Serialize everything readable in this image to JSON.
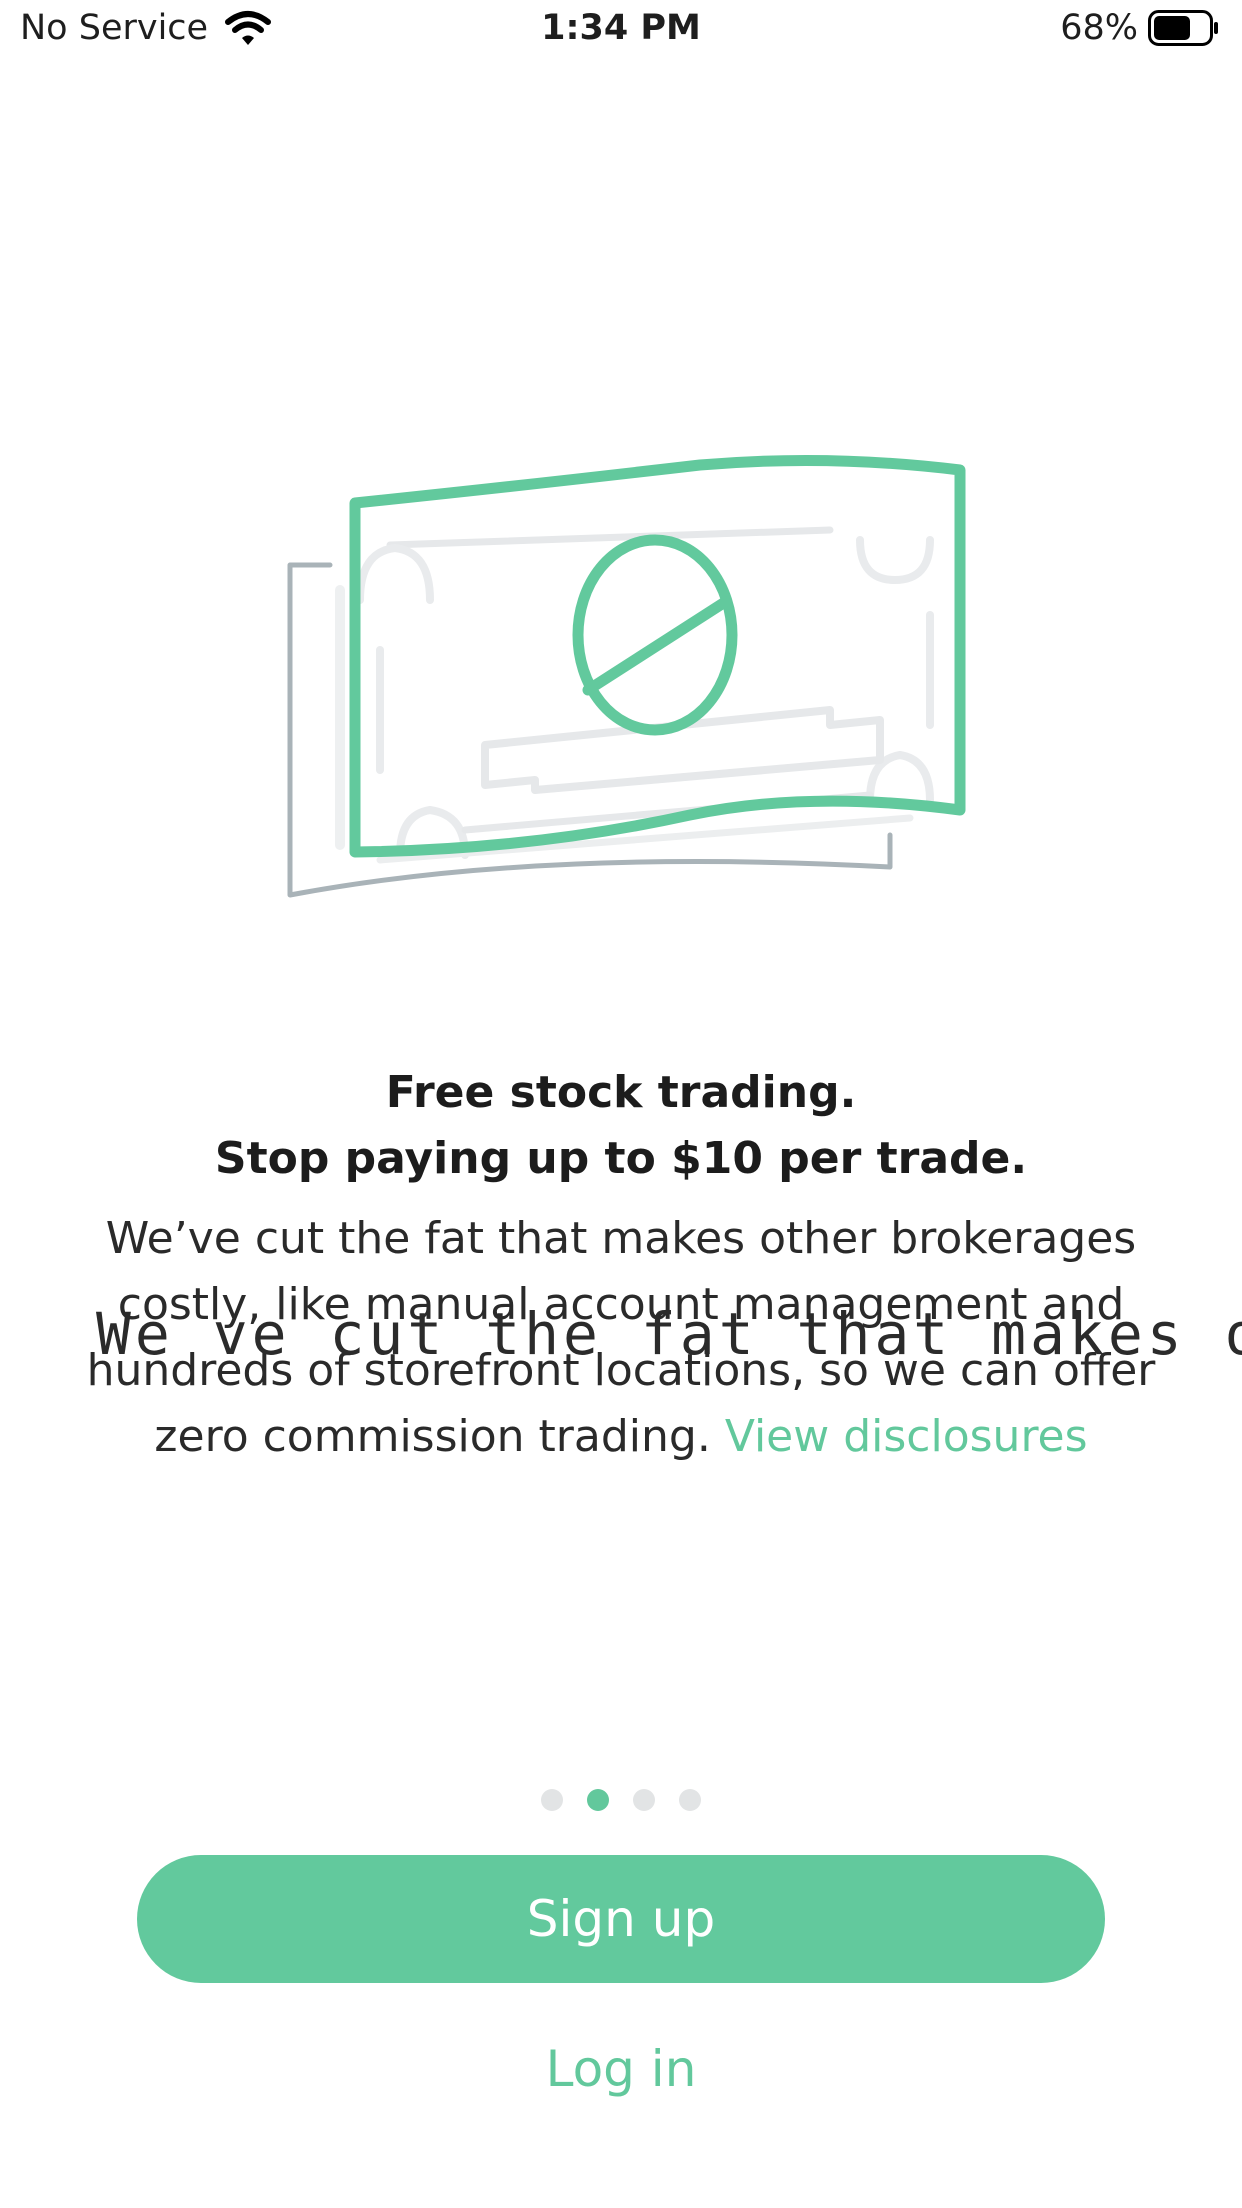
{
  "status_bar": {
    "carrier": "No Service",
    "time": "1:34 PM",
    "battery_percent": "68%",
    "battery_level": 0.68
  },
  "slide": {
    "headline_line1": "Free stock trading.",
    "headline_line2": "Stop paying up to $10 per trade.",
    "body_line1": "We’ve cut the fat that makes other brokerages",
    "body_line2": "costly, like manual account management and",
    "body_line3": "hundreds of storefront locations, so we can offer",
    "body_line4": "zero commission trading.",
    "disclosures_link": "View disclosures",
    "overlay_text": "We ve cut the fat that makes other b"
  },
  "pagination": {
    "total": 4,
    "active_index": 1
  },
  "actions": {
    "signup_label": "Sign up",
    "login_label": "Log in"
  },
  "colors": {
    "accent": "#62c99d",
    "dot_inactive": "#e2e4e5",
    "bill_gray": "#a9b3b8"
  },
  "icons": {
    "wifi": "wifi-icon",
    "battery": "battery-icon",
    "illustration": "dollar-bill-illustration"
  }
}
